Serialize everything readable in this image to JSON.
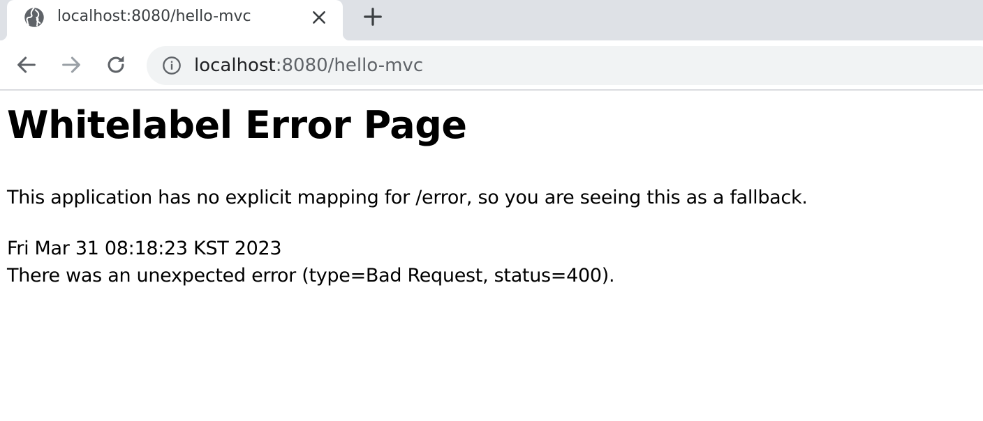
{
  "browser": {
    "tab": {
      "title": "localhost:8080/hello-mvc",
      "favicon": "globe-icon"
    },
    "new_tab_icon": "plus-icon",
    "nav": {
      "back_icon": "back-arrow-icon",
      "forward_icon": "forward-arrow-icon",
      "reload_icon": "reload-icon"
    },
    "address_bar": {
      "site_info_icon": "info-icon",
      "host": "localhost",
      "rest": ":8080/hello-mvc"
    }
  },
  "page": {
    "heading": "Whitelabel Error Page",
    "message": "This application has no explicit mapping for /error, so you are seeing this as a fallback.",
    "timestamp": "Fri Mar 31 08:18:23 KST 2023",
    "error_detail": "There was an unexpected error (type=Bad Request, status=400)."
  },
  "colors": {
    "tabstrip_bg": "#dee1e6",
    "omnibox_bg": "#f1f3f4",
    "icon_color": "#5f6368",
    "disabled_icon_color": "#9aa0a6"
  }
}
